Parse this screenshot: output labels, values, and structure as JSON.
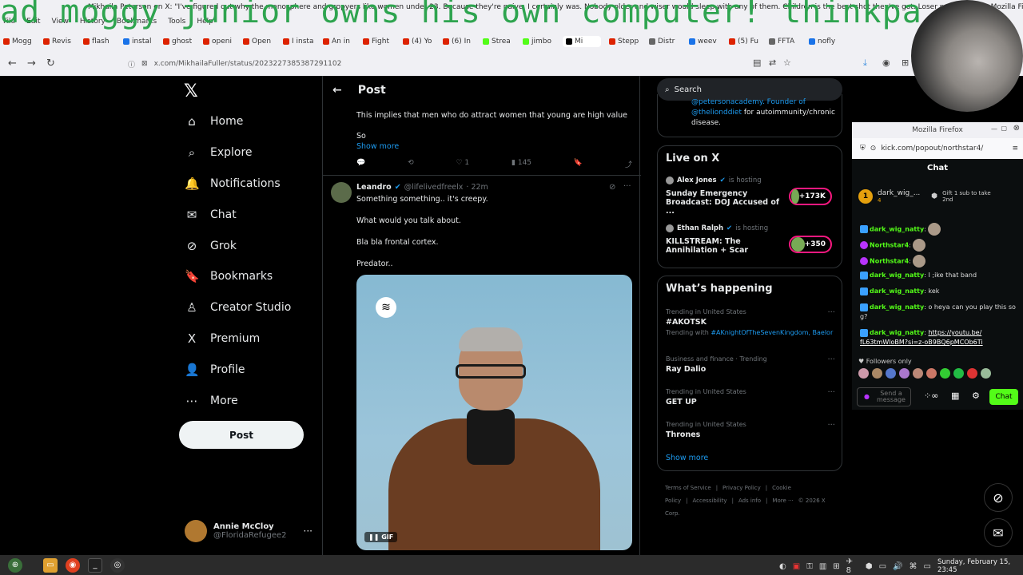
{
  "window": {
    "title": "Mikhaila Peterson on X: \"I've figured out why the manosphere and gropyers like women under 23. Because they're naive. I certainly was. Nobody older and wiser would sleep with any of them. Children is the best shot they've got. Loser pedos.\" / X — Mozilla Fi",
    "overlay_text": "ad moggy junior owns his own computer! thinkpa",
    "menu": [
      "File",
      "Edit",
      "View",
      "History",
      "Bookmarks",
      "Tools",
      "Help"
    ]
  },
  "tabs": [
    {
      "label": "Mogg",
      "color": "#d20"
    },
    {
      "label": "Revis",
      "color": "#d20"
    },
    {
      "label": "flash",
      "color": "#d20"
    },
    {
      "label": "instal",
      "color": "#1a73e8"
    },
    {
      "label": "ghost",
      "color": "#d20"
    },
    {
      "label": "openi",
      "color": "#d20"
    },
    {
      "label": "Open",
      "color": "#d20"
    },
    {
      "label": "I insta",
      "color": "#d20"
    },
    {
      "label": "An in",
      "color": "#d20"
    },
    {
      "label": "Fight",
      "color": "#d20"
    },
    {
      "label": "(4) Yo",
      "color": "#d20"
    },
    {
      "label": "(6) In",
      "color": "#d20"
    },
    {
      "label": "Strea",
      "color": "#53fc18"
    },
    {
      "label": "jimbo",
      "color": "#53fc18"
    },
    {
      "label": "Mi",
      "color": "#000"
    },
    {
      "label": "Stepp",
      "color": "#d20"
    },
    {
      "label": "Distr",
      "color": "#666"
    },
    {
      "label": "weev",
      "color": "#1a73e8"
    },
    {
      "label": "(5) Fu",
      "color": "#d20"
    },
    {
      "label": "FFTA",
      "color": "#666"
    },
    {
      "label": "nofly",
      "color": "#1a73e8"
    }
  ],
  "url": "x.com/MikhailaFuller/status/2023227385387291102",
  "x_nav": {
    "items": [
      {
        "label": "Home",
        "icon": "⌂"
      },
      {
        "label": "Explore",
        "icon": "⌕"
      },
      {
        "label": "Notifications",
        "icon": "🔔"
      },
      {
        "label": "Chat",
        "icon": "✉"
      },
      {
        "label": "Grok",
        "icon": "⊘"
      },
      {
        "label": "Bookmarks",
        "icon": "🔖"
      },
      {
        "label": "Creator Studio",
        "icon": "♙"
      },
      {
        "label": "Premium",
        "icon": "X"
      },
      {
        "label": "Profile",
        "icon": "👤"
      },
      {
        "label": "More",
        "icon": "⋯"
      }
    ],
    "post_label": "Post",
    "account": {
      "name": "Annie McCloy",
      "handle": "@FloridaRefugee2"
    }
  },
  "center": {
    "header": "Post",
    "prev_text_1": "This implies that men who do attract women that young are high value",
    "prev_text_2": "So",
    "show_more": "Show more",
    "prev_likes": "1",
    "prev_views": "145",
    "reply": {
      "name": "Leandro",
      "handle": "@lifelivedfreelx",
      "time": "· 22m",
      "lines": [
        "Something something.. it's creepy.",
        "What would you talk about.",
        "Bla bla frontal cortex.",
        "Predator.."
      ],
      "gif_label": "GIF"
    }
  },
  "right": {
    "search_placeholder": "Search",
    "bio_top": "@petersonacademy. Founder of",
    "bio_link": "@thelionddiet",
    "bio_rest": "for autoimmunity/chronic disease.",
    "live_title": "Live on X",
    "live": [
      {
        "host": "Alex Jones",
        "status": "is hosting",
        "title": "Sunday Emergency Broadcast: DOJ Accused of ...",
        "count": "+173K"
      },
      {
        "host": "Ethan Ralph",
        "status": "is hosting",
        "title": "KILLSTREAM: The Annihilation + Scar",
        "count": "+350"
      }
    ],
    "happening_title": "What’s happening",
    "trends": [
      {
        "cat": "Trending in United States",
        "name": "#AKOTSK",
        "with": "Trending with",
        "with_tags": "#AKnightOfTheSevenKingdom, Baelor"
      },
      {
        "cat": "Business and finance · Trending",
        "name": "Ray Dalio"
      },
      {
        "cat": "Trending in United States",
        "name": "GET UP"
      },
      {
        "cat": "Trending in United States",
        "name": "Thrones"
      }
    ],
    "show_more": "Show more",
    "footer": [
      "Terms of Service",
      "|",
      "Privacy Policy",
      "|",
      "Cookie Policy",
      "|",
      "Accessibility",
      "|",
      "Ads info",
      "|",
      "More ···",
      "© 2026 X Corp."
    ]
  },
  "kick": {
    "window_title": "Mozilla Firefox",
    "url": "kick.com/popout/northstar4/",
    "chat_header": "Chat",
    "gift": {
      "rank": "1",
      "user": "dark_wig_...",
      "count": "4",
      "note": "Gift 1 sub to take 2nd"
    },
    "messages": [
      {
        "user": "dark_wig_natty",
        "text": "",
        "badge": "b"
      },
      {
        "user": "Northstar4",
        "text": "",
        "badge": "p"
      },
      {
        "user": "Northstar4",
        "text": "",
        "badge": "p"
      },
      {
        "user": "dark_wig_natty",
        "text": "I ;ike that band",
        "badge": "b"
      },
      {
        "user": "dark_wig_natty",
        "text": "kek",
        "badge": "b"
      },
      {
        "user": "dark_wig_natty",
        "text": "o heya can you play this so g?",
        "badge": "b"
      },
      {
        "user": "dark_wig_natty",
        "text": "",
        "link": "https://youtu.be/ fL63tmWloBM?si=z-oB9BQ6pMCOb6Ti",
        "badge": "b"
      }
    ],
    "followers_only": "Followers only",
    "input_placeholder": "Send a message",
    "chat_button": "Chat"
  },
  "taskbar": {
    "clock": "Sunday, February 15, 23:45",
    "tray_num": "8"
  }
}
